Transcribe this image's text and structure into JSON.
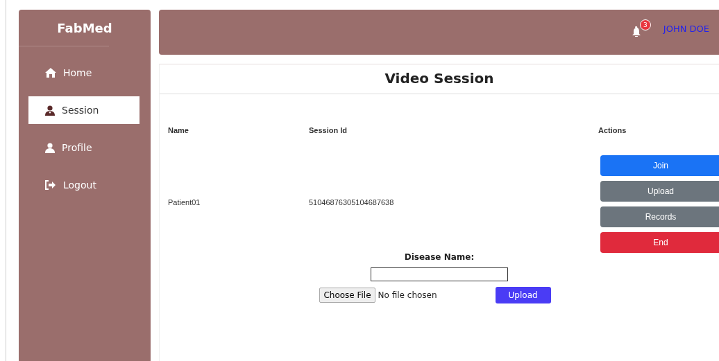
{
  "sidebar": {
    "brand": "FabMed",
    "items": [
      {
        "label": "Home",
        "kind": "home",
        "selected": false
      },
      {
        "label": "Session",
        "kind": "doctor",
        "selected": true
      },
      {
        "label": "Profile",
        "kind": "user",
        "selected": false
      },
      {
        "label": "Logout",
        "kind": "logout",
        "selected": false
      }
    ]
  },
  "header": {
    "notification_count": "3",
    "user": "JOHN DOE"
  },
  "page_title": "Video Session",
  "table": {
    "columns": [
      "Name",
      "Session Id",
      "Actions"
    ],
    "rows": [
      {
        "name": "Patient01",
        "session_id": "51046876305104687638",
        "actions": [
          {
            "label": "Join",
            "kind": "primary"
          },
          {
            "label": "Upload",
            "kind": "secondary"
          },
          {
            "label": "Records",
            "kind": "secondary"
          },
          {
            "label": "End",
            "kind": "danger"
          }
        ]
      }
    ]
  },
  "upload_form": {
    "label": "Disease Name:",
    "file_button": "Choose File",
    "file_status": "No file chosen",
    "submit": "Upload"
  }
}
